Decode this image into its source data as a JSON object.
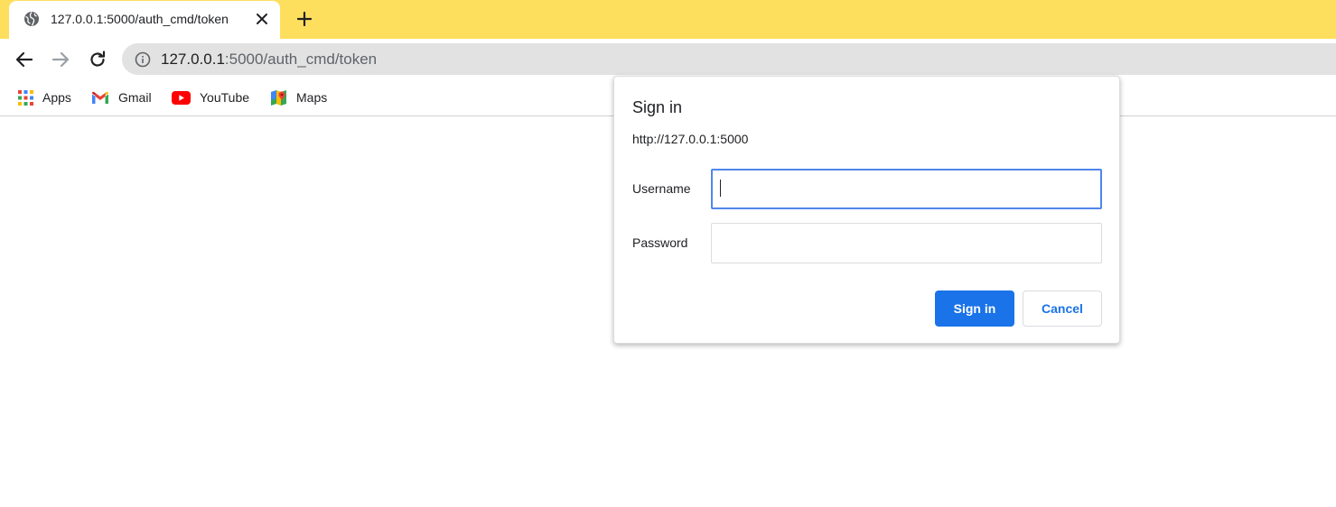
{
  "tab": {
    "title": "127.0.0.1:5000/auth_cmd/token",
    "favicon": "globe-icon"
  },
  "omnibox": {
    "host": "127.0.0.1",
    "path": ":5000/auth_cmd/token"
  },
  "bookmarks": [
    {
      "label": "Apps",
      "icon": "apps-grid-icon"
    },
    {
      "label": "Gmail",
      "icon": "gmail-icon"
    },
    {
      "label": "YouTube",
      "icon": "youtube-icon"
    },
    {
      "label": "Maps",
      "icon": "maps-icon"
    }
  ],
  "dialog": {
    "title": "Sign in",
    "origin": "http://127.0.0.1:5000",
    "username_label": "Username",
    "username_value": "",
    "password_label": "Password",
    "password_value": "",
    "sign_in_label": "Sign in",
    "cancel_label": "Cancel"
  },
  "colors": {
    "tabstrip": "#fedf5d",
    "accent": "#1a73e8",
    "focus_border": "#4f86ec"
  }
}
